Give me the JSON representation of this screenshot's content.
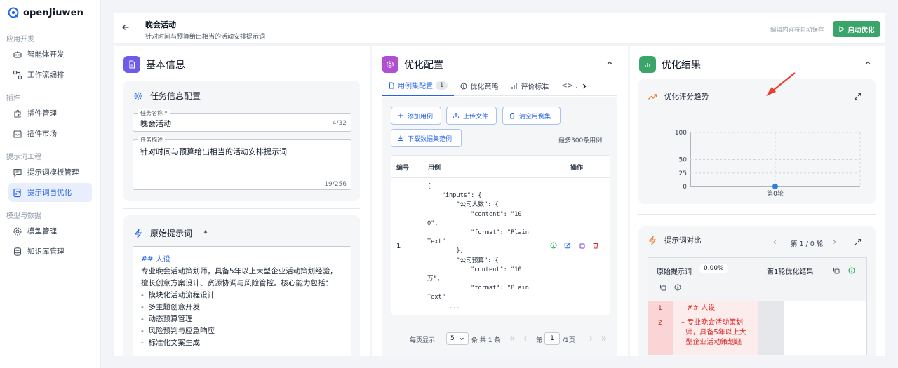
{
  "brand": {
    "name": "openJiuwen"
  },
  "sidebar": {
    "sections": [
      {
        "title": "应用开发"
      },
      {
        "title": "插件"
      },
      {
        "title": "提示词工程"
      },
      {
        "title": "模型与数据"
      }
    ],
    "items": [
      {
        "label": "智能体开发",
        "icon": "robot-icon"
      },
      {
        "label": "工作流编排",
        "icon": "workflow-icon"
      },
      {
        "label": "插件管理",
        "icon": "plugin-icon"
      },
      {
        "label": "插件市场",
        "icon": "store-icon"
      },
      {
        "label": "提示词模板管理",
        "icon": "chat-template-icon"
      },
      {
        "label": "提示词自优化",
        "icon": "prompt-optimize-icon",
        "active": true
      },
      {
        "label": "模型管理",
        "icon": "model-gear-icon"
      },
      {
        "label": "知识库管理",
        "icon": "database-icon"
      }
    ]
  },
  "header": {
    "title": "晚会活动",
    "subtitle": "针对时间与预算给出相当的活动安排提示词",
    "autosave": "编辑内容将自动保存",
    "start_button": "启动优化"
  },
  "basic_info": {
    "title": "基本信息",
    "task_config": {
      "title": "任务信息配置",
      "name_label": "任务名称 *",
      "name_value": "晚会活动",
      "name_count": "4/32",
      "desc_label": "任务描述",
      "desc_value": "针对时间与预算给出相当的活动安排提示词",
      "desc_count": "19/256"
    },
    "original_prompt": {
      "title": "原始提示词",
      "required": "*",
      "lines": [
        "## 人设",
        "专业晚会活动策划师，具备5年以上大型企业活动策划经验，",
        "擅长创意方案设计、资源协调与风险管控。核心能力包括：",
        "-  模块化活动流程设计",
        "-  多主题创意开发",
        "-  动态预算管理",
        "-  风险预判与应急响应",
        "-  标准化文案生成"
      ]
    }
  },
  "opt_config": {
    "title": "优化配置",
    "tabs": [
      {
        "label": "用例集配置",
        "badge": "1",
        "active": true
      },
      {
        "label": "优化策略"
      },
      {
        "label": "评价标准"
      },
      {
        "label": "<> ."
      }
    ],
    "buttons": {
      "add_case": "添加用例",
      "upload": "上传文件",
      "clear": "清空用例集",
      "download": "下载数据集范例"
    },
    "max_cases": "最多300条用例",
    "table": {
      "columns": [
        "编号",
        "用例",
        "操作"
      ],
      "rows": [
        {
          "id": "1",
          "code": "{\n    \"inputs\": {\n        \"公司人数\": {\n            \"content\": \"10\n0\",\n            \"format\": \"Plain\nText\"\n        },\n        \"公司预算\": {\n            \"content\": \"10\n万\",\n            \"format\": \"Plain\nText\"\n      ..."
        }
      ]
    },
    "pagination": {
      "per_page_label": "每页显示",
      "per_page": "5",
      "total_text": "条  共 1 条",
      "page_prefix": "第",
      "page": "1",
      "page_suffix": "/1页"
    }
  },
  "opt_result": {
    "title": "优化结果",
    "trend": {
      "title": "优化评分趋势"
    },
    "compare": {
      "title": "提示词对比",
      "round_nav": "第 1 / 0 轮",
      "original_label": "原始提示词",
      "original_score": "0.00%",
      "round_label": "第1轮优化结果",
      "diff": [
        {
          "n": "1",
          "text": "– ## 人设"
        },
        {
          "n": "2",
          "text": "– 专业晚会活动策划\n  师，具备5年以上大\n  型企业活动策划经"
        }
      ]
    }
  },
  "chart_data": {
    "type": "line",
    "title": "优化评分趋势",
    "categories": [
      "第0轮"
    ],
    "series": [
      {
        "values": [
          0
        ]
      }
    ],
    "ylim": [
      0,
      100
    ],
    "yticks": [
      0,
      25,
      50,
      100
    ],
    "grid": true,
    "color": "#2f7de1"
  },
  "colors": {
    "accent": "#2563eb",
    "start_button": "#3aa46b",
    "deleted": "#dc2626"
  }
}
